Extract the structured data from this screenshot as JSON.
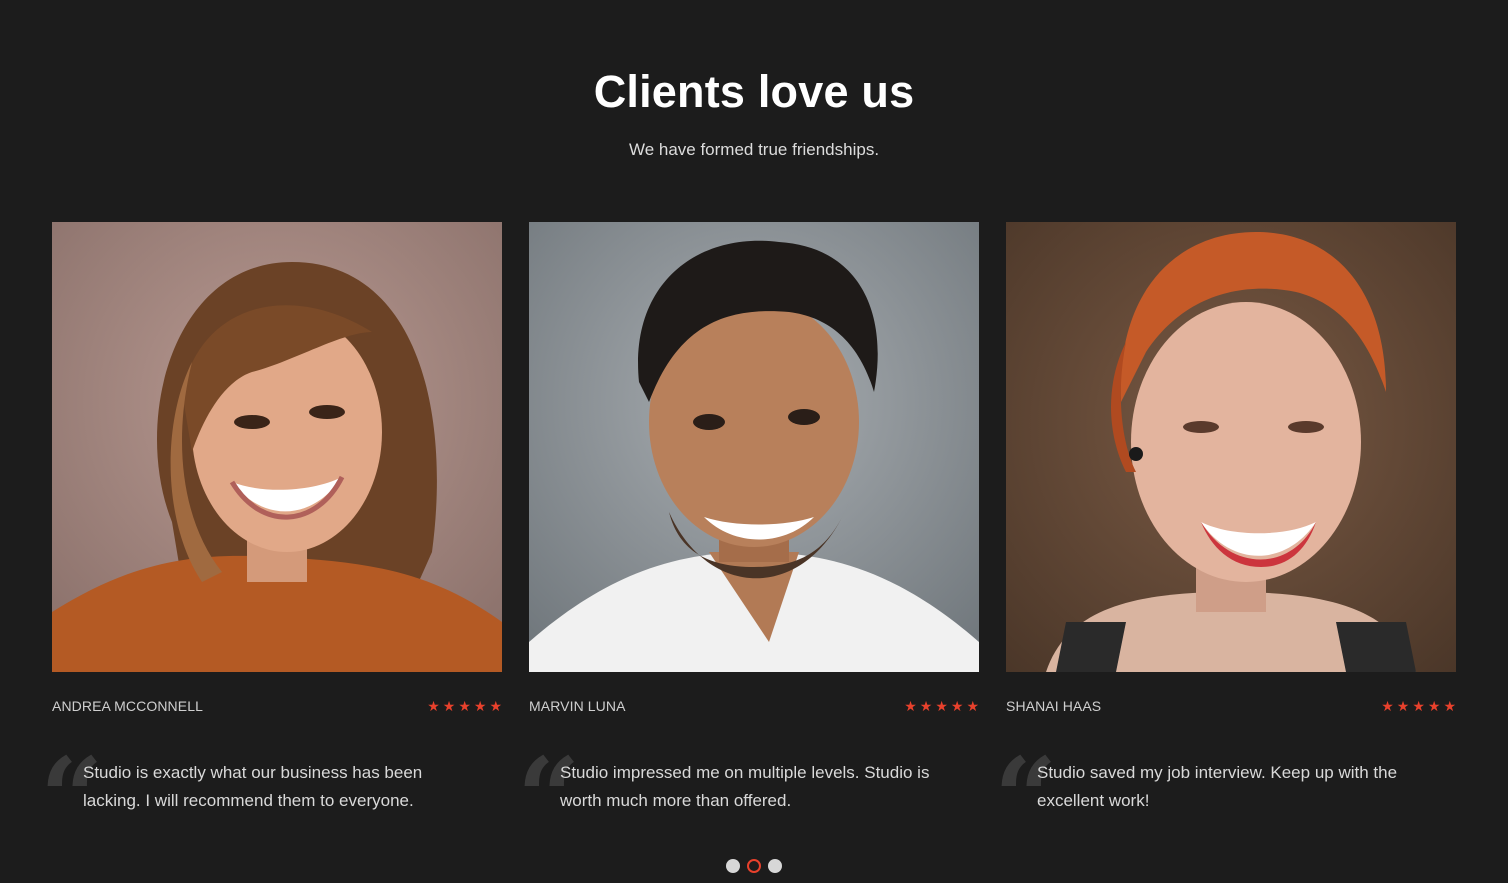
{
  "header": {
    "title": "Clients love us",
    "subtitle": "We have formed true friendships."
  },
  "testimonials": [
    {
      "name": "ANDREA MCCONNELL",
      "rating": 5,
      "quote": "Studio is exactly what our business has been lacking. I will recommend them to everyone.",
      "quote_mark": "“"
    },
    {
      "name": "MARVIN LUNA",
      "rating": 5,
      "quote": "Studio impressed me on multiple levels. Studio is worth much more than offered.",
      "quote_mark": "“"
    },
    {
      "name": "SHANAI HAAS",
      "rating": 5,
      "quote": "Studio saved my job interview. Keep up with the excellent work!",
      "quote_mark": "“"
    }
  ],
  "pagination": {
    "count": 3,
    "active_index": 1
  },
  "colors": {
    "background": "#1c1c1c",
    "accent": "#e8412c",
    "star": "#e8412c"
  },
  "icons": {
    "star": "star-icon",
    "quote": "quote-icon"
  }
}
